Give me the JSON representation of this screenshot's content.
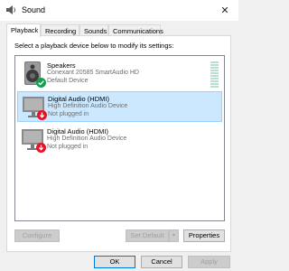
{
  "window": {
    "title": "Sound",
    "close_glyph": "✕"
  },
  "tabs": [
    {
      "label": "Playback"
    },
    {
      "label": "Recording"
    },
    {
      "label": "Sounds"
    },
    {
      "label": "Communications"
    }
  ],
  "instruction": "Select a playback device below to modify its settings:",
  "devices": [
    {
      "name": "Speakers",
      "line2": "Conexant 20585 SmartAudio HD",
      "line3": "Default Device",
      "status": "default",
      "icon": "speakers-icon"
    },
    {
      "name": "Digital Audio (HDMI)",
      "line2": "High Definition Audio Device",
      "line3": "Not plugged in",
      "status": "not-plugged",
      "icon": "monitor-icon"
    },
    {
      "name": "Digital Audio (HDMI)",
      "line2": "High Definition Audio Device",
      "line3": "Not plugged in",
      "status": "not-plugged",
      "icon": "monitor-icon"
    }
  ],
  "buttons": {
    "configure": "Configure",
    "set_default": "Set Default",
    "properties": "Properties",
    "ok": "OK",
    "cancel": "Cancel",
    "apply": "Apply"
  },
  "colors": {
    "selection": "#cce8ff",
    "default_check": "#0fa150",
    "unplugged_arrow": "#e81123"
  }
}
